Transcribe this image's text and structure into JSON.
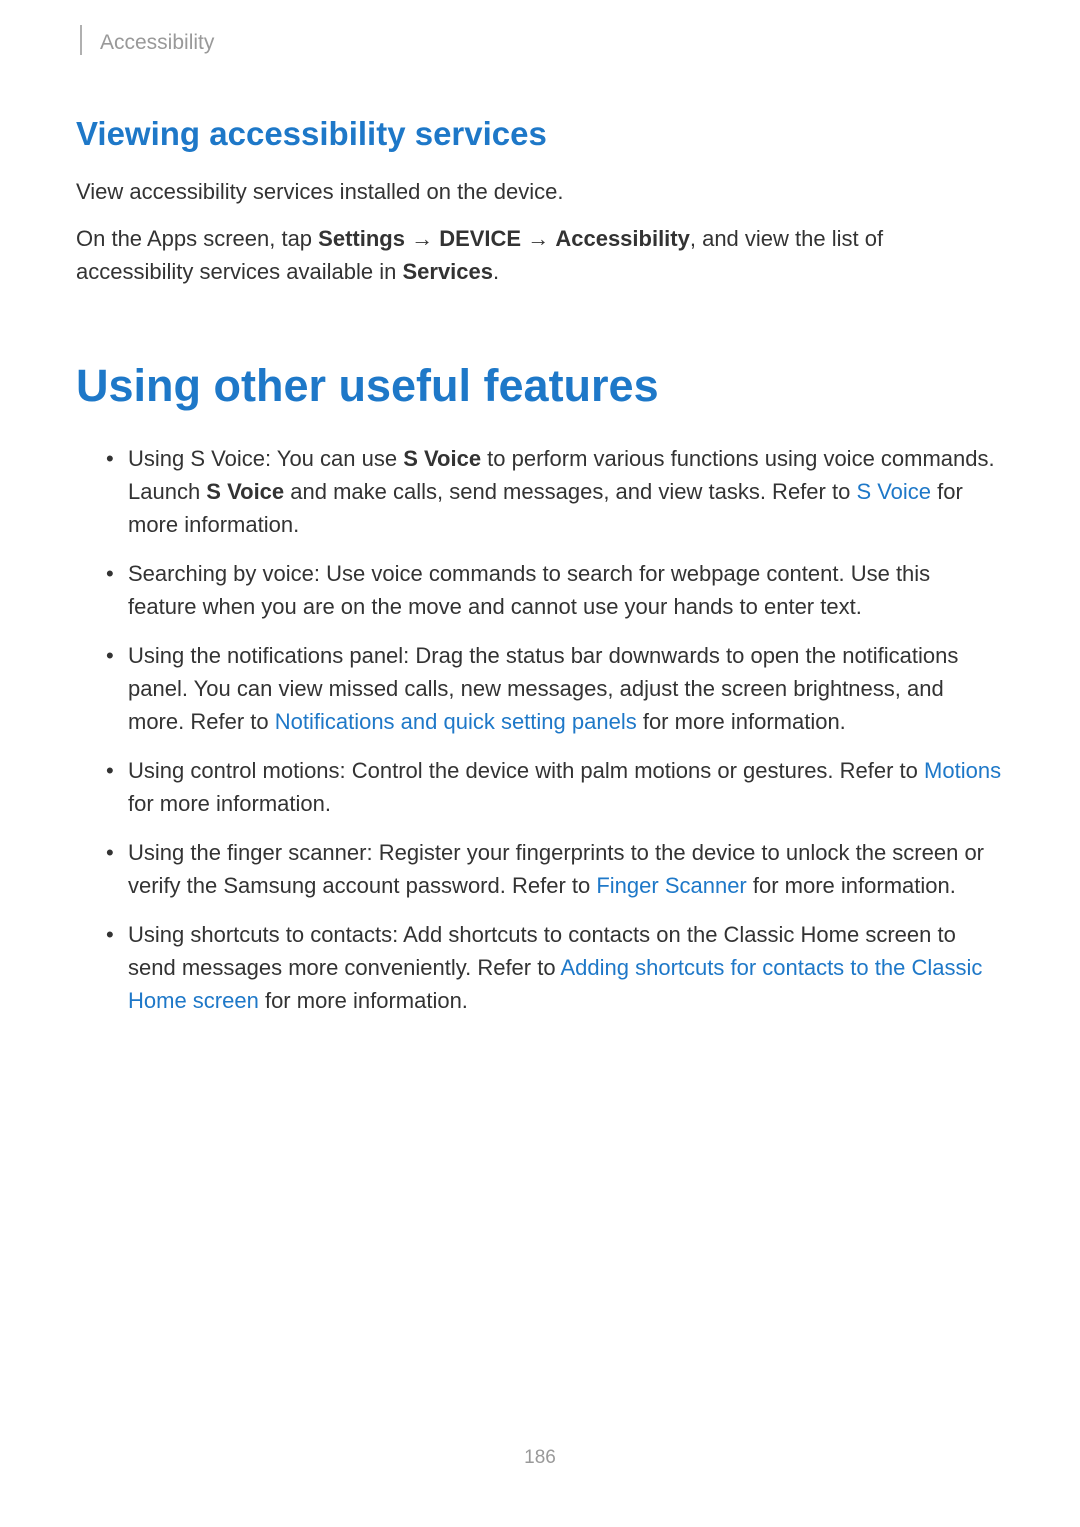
{
  "breadcrumb": "Accessibility",
  "section_heading": "Viewing accessibility services",
  "intro_para": "View accessibility services installed on the device.",
  "nav_para": {
    "pre": "On the Apps screen, tap ",
    "settings": "Settings",
    "arrow": " → ",
    "device": "DEVICE",
    "accessibility": "Accessibility",
    "mid": ", and view the list of accessibility services available in ",
    "services": "Services",
    "end": "."
  },
  "main_heading": "Using other useful features",
  "items": [
    {
      "pre": "Using S Voice: You can use ",
      "b1": "S Voice",
      "mid1": " to perform various functions using voice commands. Launch ",
      "b2": "S Voice",
      "mid2": " and make calls, send messages, and view tasks. Refer to ",
      "link": "S Voice",
      "post": " for more information."
    },
    {
      "text": "Searching by voice: Use voice commands to search for webpage content. Use this feature when you are on the move and cannot use your hands to enter text."
    },
    {
      "pre": "Using the notifications panel: Drag the status bar downwards to open the notifications panel. You can view missed calls, new messages, adjust the screen brightness, and more. Refer to ",
      "link": "Notifications and quick setting panels",
      "post": " for more information."
    },
    {
      "pre": "Using control motions: Control the device with palm motions or gestures. Refer to ",
      "link": "Motions",
      "post": " for more information."
    },
    {
      "pre": "Using the finger scanner: Register your fingerprints to the device to unlock the screen or verify the Samsung account password. Refer to ",
      "link": "Finger Scanner",
      "post": " for more information."
    },
    {
      "pre": "Using shortcuts to contacts: Add shortcuts to contacts on the Classic Home screen to send messages more conveniently. Refer to ",
      "link": "Adding shortcuts for contacts to the Classic Home screen",
      "post": " for more information."
    }
  ],
  "page_number": "186"
}
